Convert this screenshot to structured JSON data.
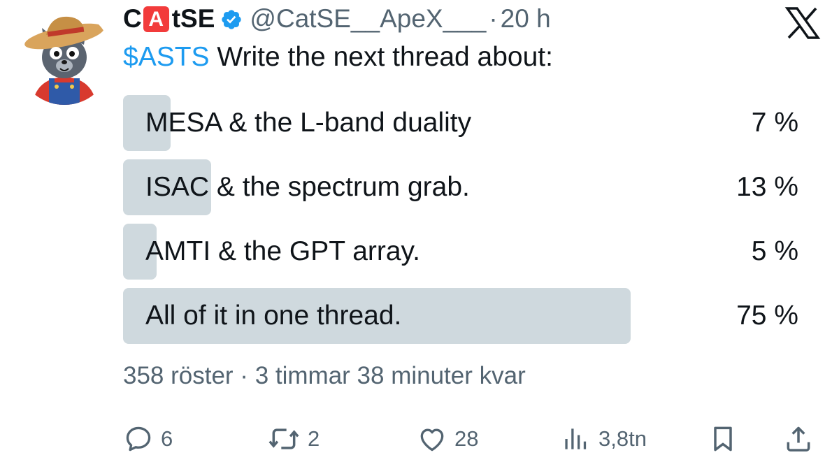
{
  "author": {
    "name_prefix": "C",
    "name_emoji": "A",
    "name_suffix": "tSE",
    "handle": "@CatSE__ApeX___",
    "separator": "·",
    "time": "20 h",
    "avatar_icon": "cat-farmer-avatar",
    "verified_icon": "verified-badge-icon"
  },
  "brand_icon": "x-logo-icon",
  "tweet": {
    "cashtag": "$ASTS",
    "text": " Write the next thread about:"
  },
  "poll": {
    "options": [
      {
        "label": "MESA & the L-band duality",
        "percent": 7,
        "percent_text": "7 %"
      },
      {
        "label": "ISAC & the spectrum grab.",
        "percent": 13,
        "percent_text": "13 %"
      },
      {
        "label": "AMTI & the GPT array.",
        "percent": 5,
        "percent_text": "5 %"
      },
      {
        "label": "All of it in one thread.",
        "percent": 75,
        "percent_text": "75 %"
      }
    ],
    "summary": "358 röster · 3 timmar 38 minuter kvar"
  },
  "actions": {
    "reply_count": "6",
    "repost_count": "2",
    "like_count": "28",
    "views_count": "3,8tn"
  },
  "colors": {
    "accent": "#1d9bf0",
    "bar": "#cfd9de",
    "secondary_text": "#536471",
    "primary_text": "#0f1419"
  }
}
